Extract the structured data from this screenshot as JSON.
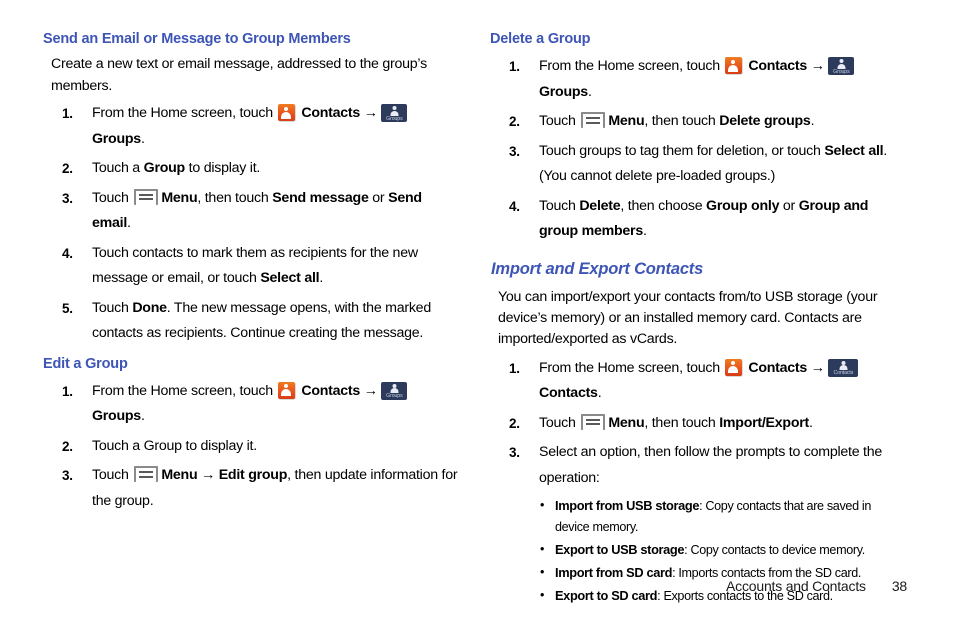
{
  "document": {
    "footer": {
      "chapter_label": "Accounts and Contacts",
      "page_number": "38"
    },
    "colors": {
      "heading_blue": "#3d55b5",
      "contacts_icon_orange": "#e8541d",
      "tab_icon_navy": "#2c3a5c",
      "menu_icon_gray": "#8a8a8a"
    }
  },
  "icons": {
    "contacts_app": "contacts-app-icon",
    "groups_tab": "groups-tab-icon",
    "contacts_tab": "contacts-tab-icon",
    "menu_key": "menu-key-icon",
    "groups_tab_caption": "Groups",
    "contacts_tab_caption": "Contacts"
  },
  "left_column": {
    "heading_1": "Send an Email or Message to Group Members",
    "intro": {
      "line_1": "Create a new text or email message, addressed to the",
      "line_2": "group’s members."
    },
    "steps_1": [
      {
        "num": "1.",
        "pre": "From the Home screen, touch",
        "app_label": "Contacts",
        "arrow": "→",
        "tab_label": "Groups",
        "post": "."
      },
      {
        "num": "2.",
        "pre": "Touch a",
        "bold_1": "Group",
        "post": "to display it."
      },
      {
        "num": "3.",
        "pre": "Touch",
        "menu_label": "Menu",
        "mid": ", then touch",
        "bold_1": "Send message",
        "conj": "or",
        "bold_2": "Send email",
        "post": "."
      },
      {
        "num": "4.",
        "pre": "Touch contacts to mark them as recipients for the new message or email, or touch",
        "bold_1": "Select all",
        "post": "."
      },
      {
        "num": "5.",
        "pre": "Touch",
        "bold_1": "Done",
        "post": ". The new message opens, with the marked contacts as recipients. Continue creating the message."
      }
    ],
    "heading_2": "Edit a Group",
    "steps_2": [
      {
        "num": "1.",
        "pre": "From the Home screen, touch",
        "app_label": "Contacts",
        "arrow": "→",
        "tab_label": "Groups",
        "post": "."
      },
      {
        "num": "2.",
        "pre": "Touch a Group to display it."
      },
      {
        "num": "3.",
        "pre": "Touch",
        "menu_label": "Menu",
        "arrow": "→",
        "bold_1": "Edit group",
        "post": ", then update information for the group."
      }
    ]
  },
  "right_column": {
    "heading_1": "Delete a Group",
    "steps_1": [
      {
        "num": "1.",
        "pre": "From the Home screen, touch",
        "app_label": "Contacts",
        "arrow": "→",
        "tab_label": "Groups",
        "post": "."
      },
      {
        "num": "2.",
        "pre": "Touch",
        "menu_label": "Menu",
        "mid": ", then touch",
        "bold_1": "Delete groups",
        "post": "."
      },
      {
        "num": "3.",
        "pre": "Touch groups to tag them for deletion, or touch",
        "bold_1": "Select all",
        "post": ". (You cannot delete pre-loaded groups.)"
      },
      {
        "num": "4.",
        "pre": "Touch",
        "bold_1": "Delete",
        "mid": ", then choose",
        "bold_2": "Group only",
        "conj": "or",
        "bold_3": "Group and group members",
        "post": "."
      }
    ],
    "section_heading": "Import and Export Contacts",
    "intro": {
      "line_1": "You can import/export your contacts from/to USB storage",
      "line_2": "(your device’s memory) or an installed memory card.",
      "line_3": "Contacts are imported/exported as vCards."
    },
    "steps_2": [
      {
        "num": "1.",
        "pre": "From the Home screen, touch",
        "app_label": "Contacts",
        "arrow": "→",
        "tab_label": "Contacts",
        "post": "."
      },
      {
        "num": "2.",
        "pre": "Touch",
        "menu_label": "Menu",
        "mid": ", then touch",
        "bold_1": "Import/Export",
        "post": "."
      },
      {
        "num": "3.",
        "pre": "Select an option, then follow the prompts to complete the operation:"
      }
    ],
    "bullets": [
      {
        "dot": "•",
        "term": "Import from USB storage",
        "desc": ": Copy contacts that are saved in device memory."
      },
      {
        "dot": "•",
        "term": "Export to USB storage",
        "desc": ": Copy contacts to device memory."
      },
      {
        "dot": "•",
        "term": "Import from SD card",
        "desc": ": Imports contacts from the SD card."
      },
      {
        "dot": "•",
        "term": "Export to SD card",
        "desc": ": Exports contacts to the SD card."
      }
    ]
  }
}
